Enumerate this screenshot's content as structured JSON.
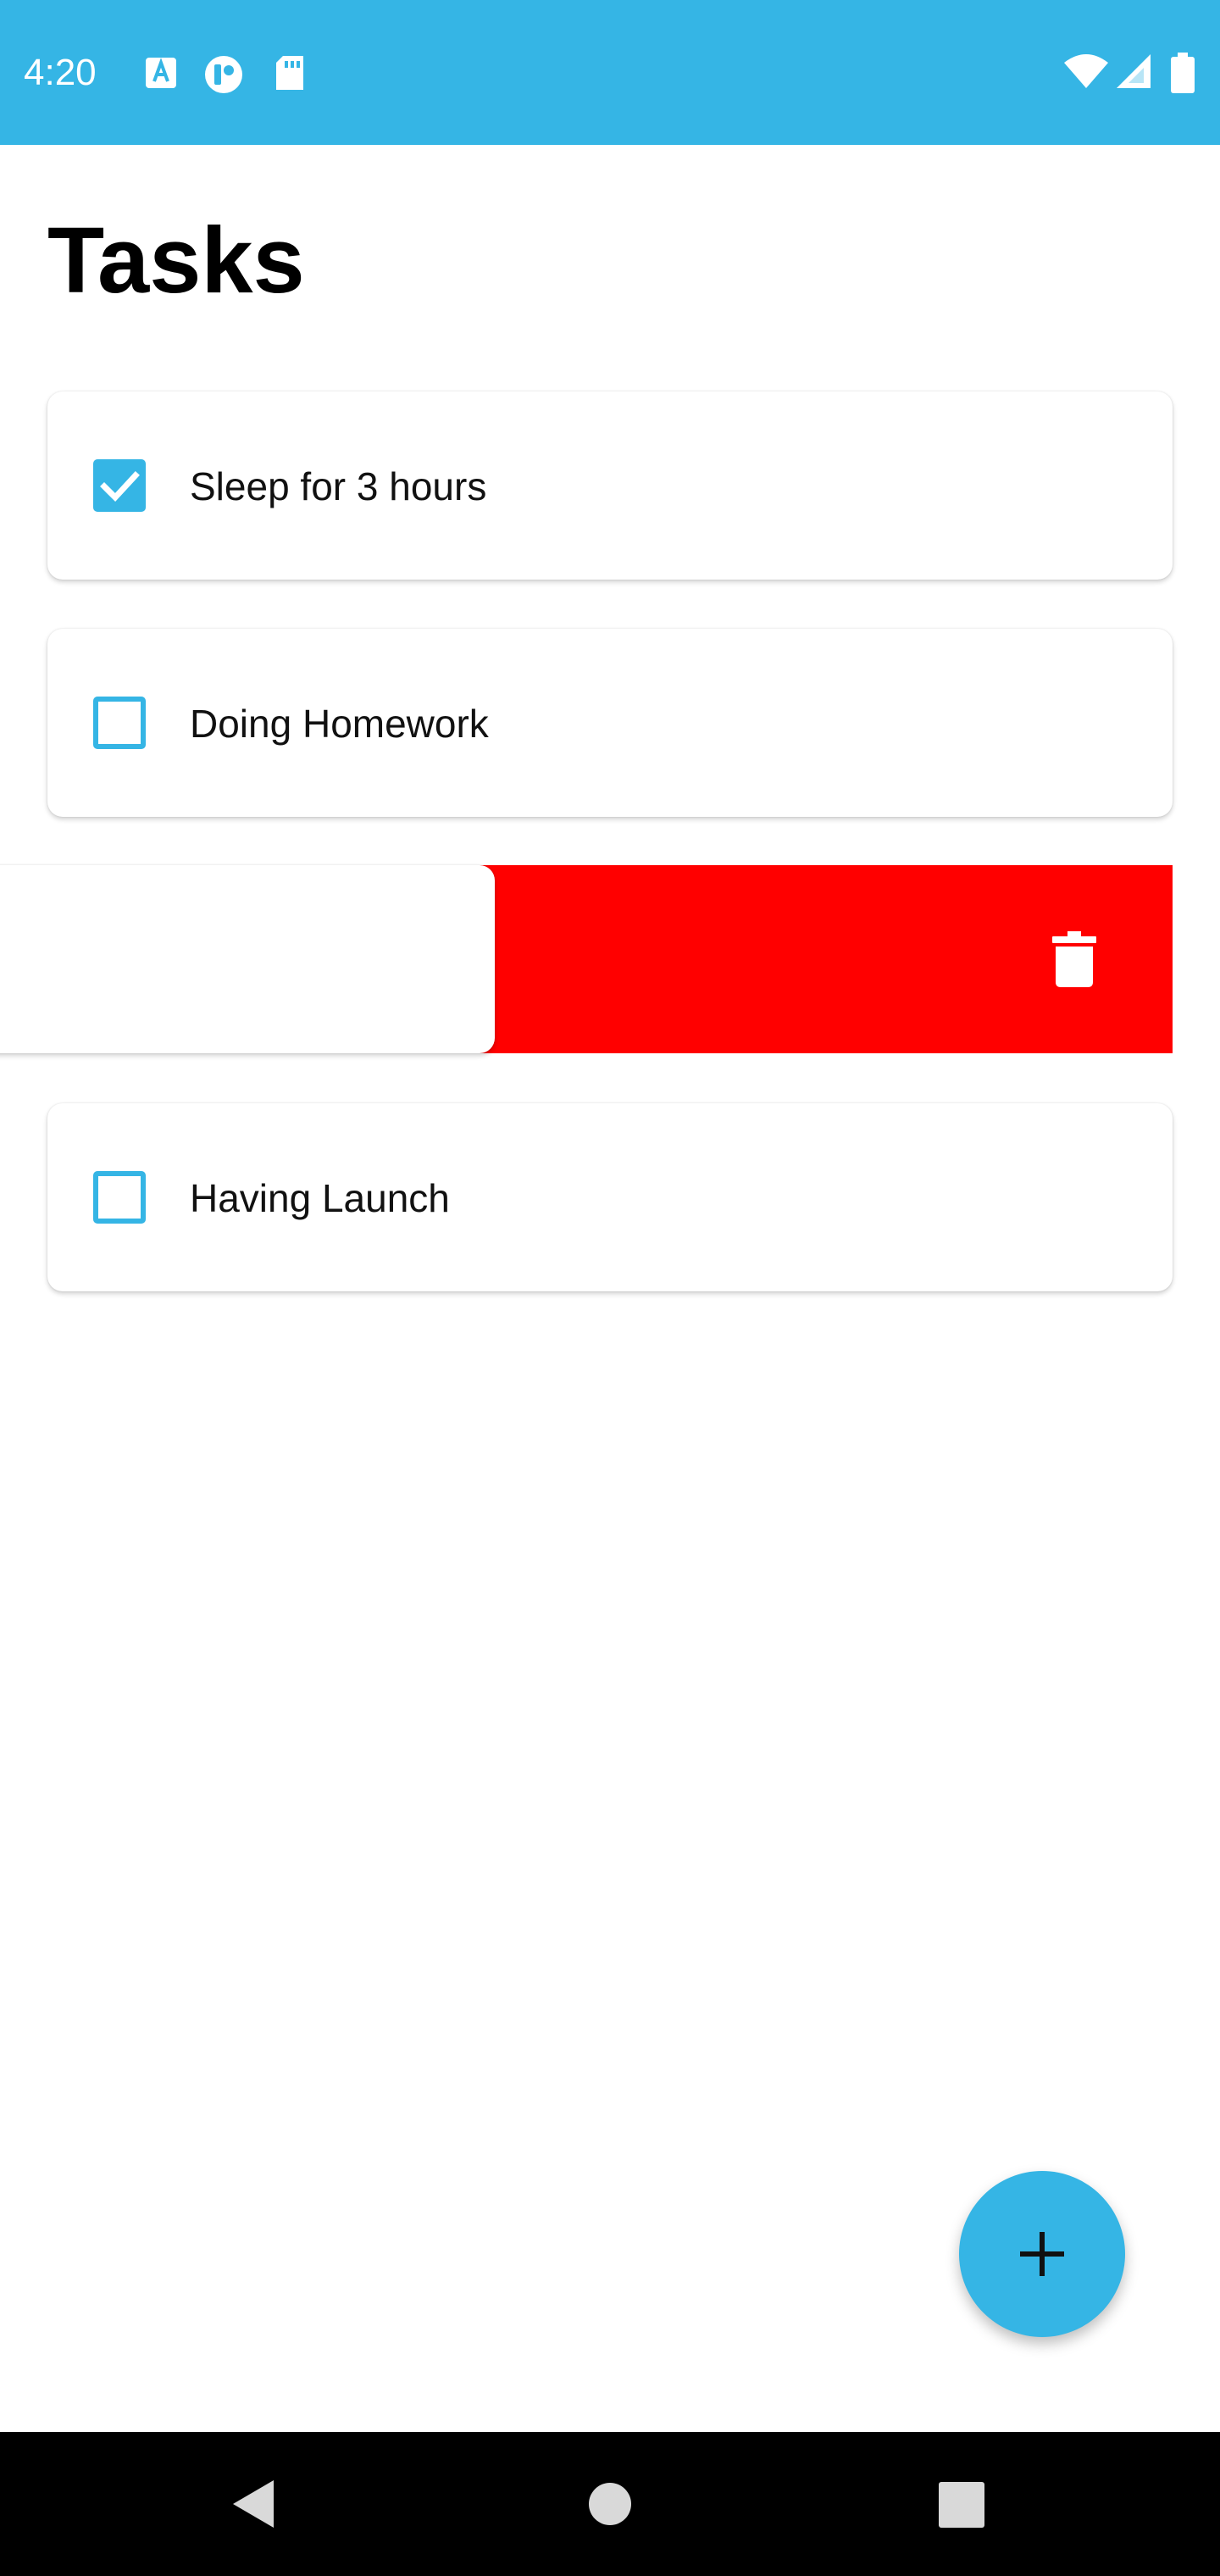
{
  "status_bar": {
    "time": "4:20",
    "bg_color": "#35b5e5",
    "left_icons": [
      "text-a-icon",
      "app-badge-icon",
      "sd-card-icon"
    ],
    "right_icons": [
      "wifi-icon",
      "cellular-signal-icon",
      "battery-icon"
    ]
  },
  "page": {
    "title": "Tasks"
  },
  "tasks": [
    {
      "label": "Sleep for 3 hours",
      "checked": true
    },
    {
      "label": "Doing Homework",
      "checked": false
    },
    {
      "label": "",
      "checked": false,
      "swiped_for_delete": true
    },
    {
      "label": "Having Launch",
      "checked": false
    }
  ],
  "swipe_delete": {
    "bg_color": "#ff0000",
    "icon": "trash-icon"
  },
  "fab": {
    "icon": "plus-icon",
    "color": "#35b5e5"
  },
  "nav_bar": {
    "buttons": [
      "back-icon",
      "home-icon",
      "recents-icon"
    ]
  },
  "colors": {
    "accent": "#35b5e5",
    "delete": "#ff0000"
  }
}
